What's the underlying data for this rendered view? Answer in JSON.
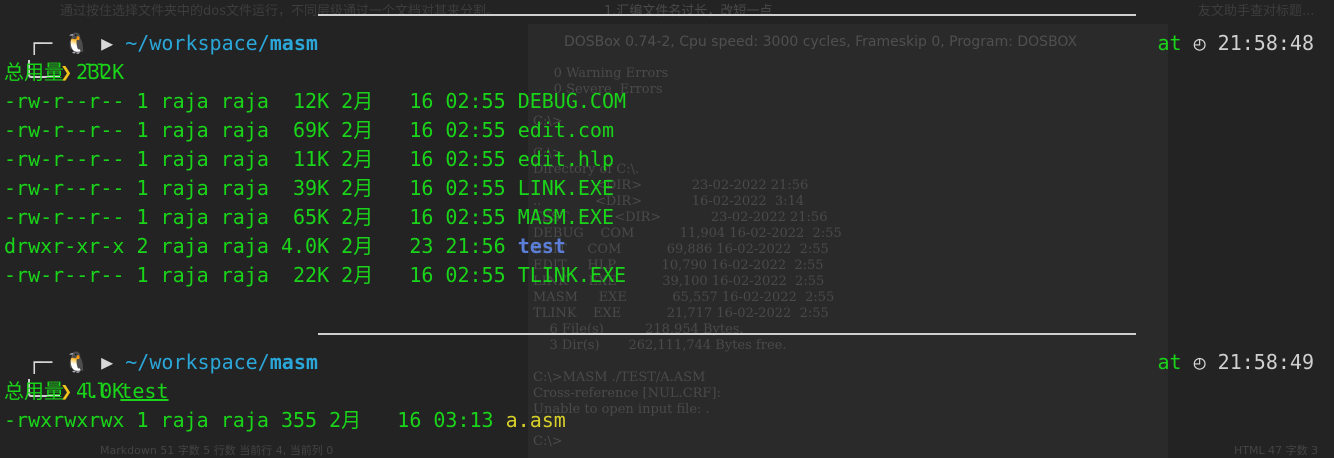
{
  "background": {
    "top_text": "通过按住选择文件夹中的dos文件运行，不同层级通过一个文档对其来分割。",
    "top_right_text": "1.汇编文件名过长，改短一点",
    "top_far_right_text": "友文助手查对标题...",
    "dosbox_title": "DOSBox 0.74-2, Cpu speed: 3000 cycles, Frameskip 0, Program: DOSBOX",
    "dos_lines": [
      "     0 Warning Errors",
      "     0 Severe  Errors",
      "",
      "C:\\>",
      "",
      "C:\\>",
      "Directory of C:\\.",
      ".              <DIR>            23-02-2022 21:56",
      "..             <DIR>            16-02-2022  3:14",
      "TEST           <DIR>            23-02-2022 21:56",
      "DEBUG    COM           11,904 16-02-2022  2:55",
      "EDIT     COM           69,886 16-02-2022  2:55",
      "EDIT     HLP           10,790 16-02-2022  2:55",
      "LINK     EXE           39,100 16-02-2022  2:55",
      "MASM     EXE           65,557 16-02-2022  2:55",
      "TLINK    EXE           21,717 16-02-2022  2:55",
      "    6 File(s)          218,954 Bytes.",
      "    3 Dir(s)       262,111,744 Bytes free.",
      "",
      "C:\\>MASM ./TEST/A.ASM",
      "Cross-reference [NUL.CRF]:",
      "Unable to open input file: .",
      "",
      "C:\\>"
    ],
    "status_left": "Markdown  51 字数  5 行数  当前行 4, 当前列 0",
    "status_right": "HTML  47 字数  3"
  },
  "prompts": [
    {
      "path_prefix": "~/workspace/",
      "path_bold": "masm",
      "at": "at",
      "time": "21:58:48",
      "command": "ll",
      "arg": ""
    },
    {
      "path_prefix": "~/workspace/",
      "path_bold": "masm",
      "at": "at",
      "time": "21:58:49",
      "command": "ll",
      "arg": "test"
    }
  ],
  "listing1": {
    "total": "总用量 232K",
    "rows": [
      {
        "meta": "-rw-r--r-- 1 raja raja  12K 2月   16 02:55 ",
        "name": "DEBUG.COM",
        "kind": "file"
      },
      {
        "meta": "-rw-r--r-- 1 raja raja  69K 2月   16 02:55 ",
        "name": "edit.com",
        "kind": "file"
      },
      {
        "meta": "-rw-r--r-- 1 raja raja  11K 2月   16 02:55 ",
        "name": "edit.hlp",
        "kind": "file"
      },
      {
        "meta": "-rw-r--r-- 1 raja raja  39K 2月   16 02:55 ",
        "name": "LINK.EXE",
        "kind": "file"
      },
      {
        "meta": "-rw-r--r-- 1 raja raja  65K 2月   16 02:55 ",
        "name": "MASM.EXE",
        "kind": "file"
      },
      {
        "meta": "drwxr-xr-x 2 raja raja 4.0K 2月   23 21:56 ",
        "name": "test",
        "kind": "dir"
      },
      {
        "meta": "-rw-r--r-- 1 raja raja  22K 2月   16 02:55 ",
        "name": "TLINK.EXE",
        "kind": "file"
      }
    ]
  },
  "listing2": {
    "total": "总用量 4.0K",
    "rows": [
      {
        "meta": "-rwxrwxrwx 1 raja raja 355 2月   16 03:13 ",
        "name": "a.asm",
        "kind": "asm"
      }
    ]
  },
  "colors": {
    "green": "#19d419",
    "blue_path": "#2aa6d8",
    "dir_blue": "#5b7fd8",
    "yellow": "#f2c31a",
    "asm_yellow": "#d8d02a"
  }
}
